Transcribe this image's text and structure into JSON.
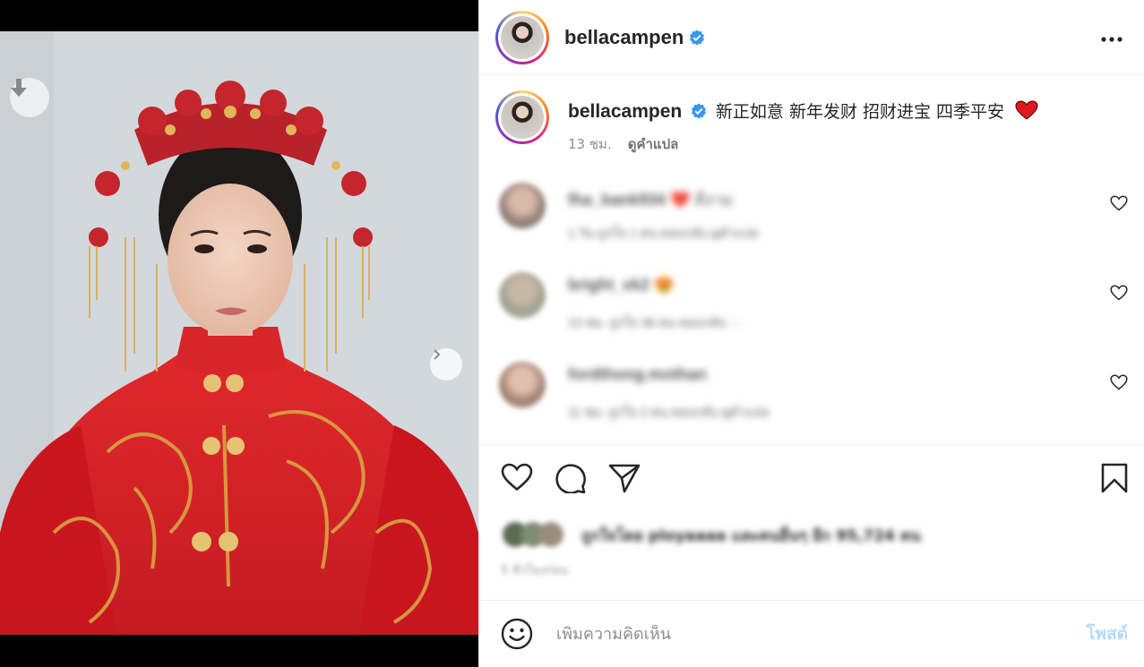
{
  "post": {
    "username": "bellacampen",
    "verified": true,
    "caption": "新正如意 新年发财 招财进宝 四季平安",
    "caption_emoji": "❤️",
    "time_ago": "13 ชม.",
    "translate_label": "ดูคำแปล",
    "more_icon": "more-horizontal-icon"
  },
  "media": {
    "carousel_count": 4,
    "carousel_active": 1
  },
  "comments": [
    {
      "username": "fha_bank934",
      "text": "❤️ ดีงาม",
      "meta": "1 วัน  ถูกใจ 1 คน  ตอบกลับ  ดูคำแปล"
    },
    {
      "username": "bright_vk2",
      "text": "😍",
      "meta": "13 ชม.  ถูกใจ 36 คน  ตอบกลับ  ···"
    },
    {
      "username": "fordthong.mothan",
      "text": "",
      "meta": "11 ชม.  ถูกใจ 2 คน  ตอบกลับ  ดูคำแปล"
    }
  ],
  "likes": {
    "text": "ถูกใจโดย ployaaaa และคนอื่นๆ อีก 95,724 คน",
    "date": "5 ชั่วโมงก่อน"
  },
  "composer": {
    "placeholder": "เพิ่มความคิดเห็น",
    "post_label": "โพสต์"
  },
  "colors": {
    "verified": "#3897f0",
    "link_disabled": "#b3dbff",
    "dress_red": "#d9262a"
  }
}
